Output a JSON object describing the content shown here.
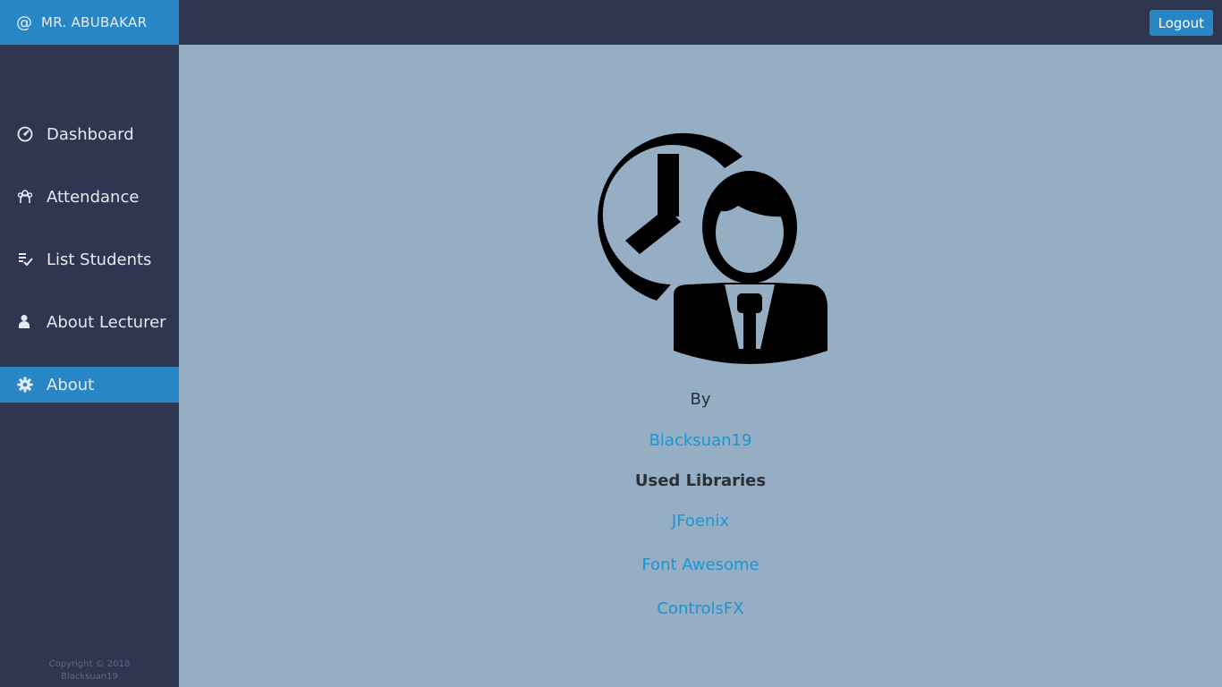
{
  "header": {
    "at_symbol": "@",
    "user_name": "MR. ABUBAKAR"
  },
  "topbar": {
    "logout_label": "Logout"
  },
  "sidebar": {
    "items": [
      {
        "label": "Dashboard",
        "icon": "dashboard-gauge-icon",
        "active": false
      },
      {
        "label": "Attendance",
        "icon": "attendance-group-icon",
        "active": false
      },
      {
        "label": "List Students",
        "icon": "list-check-icon",
        "active": false
      },
      {
        "label": "About Lecturer",
        "icon": "user-icon",
        "active": false
      },
      {
        "label": "About",
        "icon": "gear-icon",
        "active": true
      }
    ],
    "copyright": [
      "Copyright © 2018",
      "Blacksuan19"
    ]
  },
  "about": {
    "by_label": "By",
    "author": "Blacksuan19",
    "libraries_heading": "Used Libraries",
    "libraries": [
      "JFoenix",
      "Font Awesome",
      "ControlsFX"
    ],
    "hero_icon": "clock-user-icon"
  },
  "colors": {
    "sidebar_bg": "#2e3650",
    "accent": "#2986c6",
    "content_bg": "#96aec3",
    "link": "#1a96d4"
  }
}
